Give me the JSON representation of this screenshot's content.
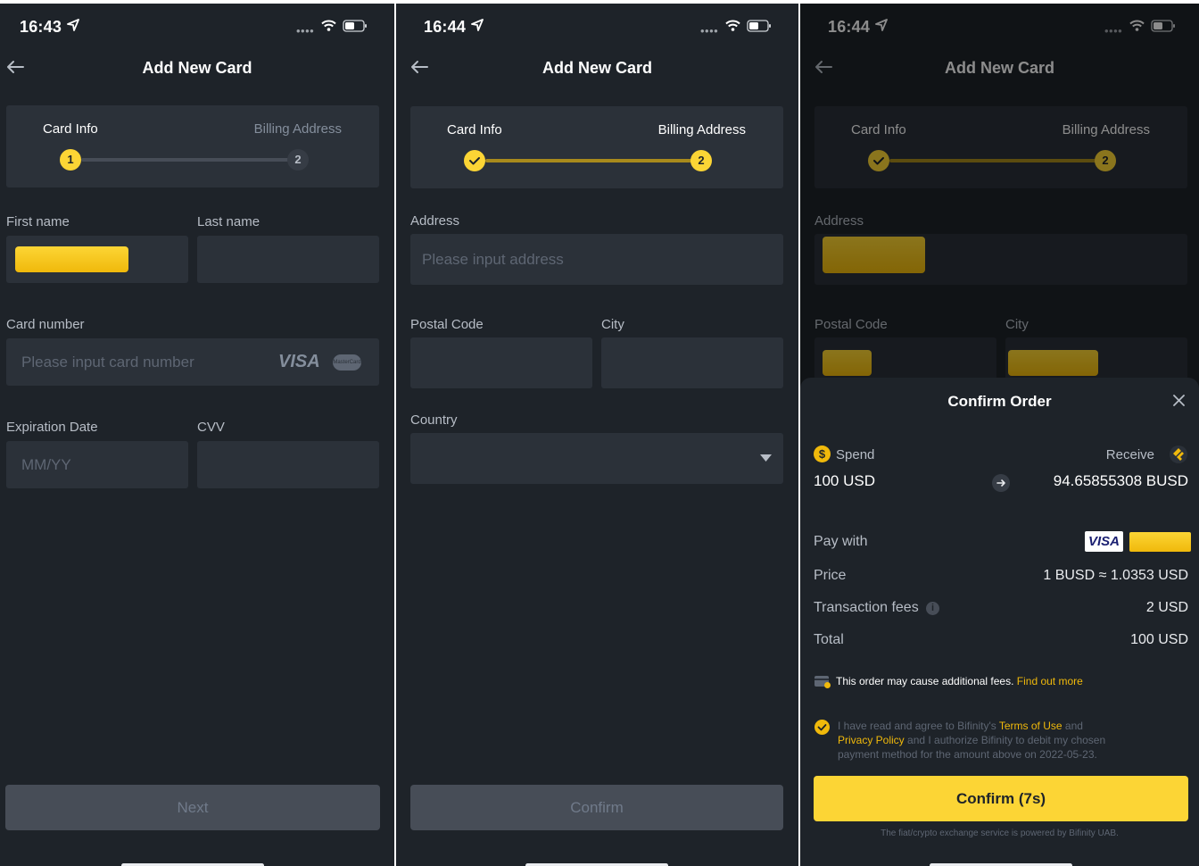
{
  "screens": [
    {
      "status": {
        "time": "16:43"
      },
      "title": "Add New Card",
      "steps": {
        "step1": "Card Info",
        "step2": "Billing Address",
        "dot1": "1",
        "dot2": "2"
      },
      "fields": {
        "first_name_label": "First name",
        "last_name_label": "Last name",
        "card_number_label": "Card number",
        "card_number_placeholder": "Please input card number",
        "expiration_label": "Expiration Date",
        "expiration_placeholder": "MM/YY",
        "cvv_label": "CVV"
      },
      "card_brands": {
        "visa": "VISA",
        "mastercard": "MasterCard"
      },
      "button": "Next"
    },
    {
      "status": {
        "time": "16:44"
      },
      "title": "Add New Card",
      "steps": {
        "step1": "Card Info",
        "step2": "Billing Address",
        "dot2": "2"
      },
      "fields": {
        "address_label": "Address",
        "address_placeholder": "Please input address",
        "postal_label": "Postal Code",
        "city_label": "City",
        "country_label": "Country"
      },
      "button": "Confirm"
    },
    {
      "status": {
        "time": "16:44"
      },
      "title": "Add New Card",
      "steps": {
        "step1": "Card Info",
        "step2": "Billing Address",
        "dot2": "2"
      },
      "fields": {
        "address_label": "Address",
        "postal_label": "Postal Code",
        "city_label": "City"
      },
      "sheet": {
        "title": "Confirm Order",
        "spend_label": "Spend",
        "spend_value": "100 USD",
        "receive_label": "Receive",
        "receive_value": "94.65855308 BUSD",
        "pay_with_label": "Pay with",
        "pay_with_brand": "VISA",
        "price_label": "Price",
        "price_value": "1 BUSD ≈ 1.0353 USD",
        "fees_label": "Transaction fees",
        "fees_value": "2 USD",
        "total_label": "Total",
        "total_value": "100 USD",
        "notice_text": "This order may cause additional fees.",
        "notice_link": "Find out more",
        "agree_1": "I have read and agree to Bifinity's",
        "agree_terms": "Terms of Use",
        "agree_and": "and",
        "agree_privacy": "Privacy Policy",
        "agree_2": "and I authorize Bifinity to debit my chosen",
        "agree_3": "payment method for the amount above on 2022-05-23.",
        "confirm_button": "Confirm (7s)",
        "footer": "The fiat/crypto exchange service is powered by Bifinity UAB."
      }
    }
  ],
  "colors": {
    "accent": "#fcd535",
    "bg": "#1e2329",
    "field": "#2b3139",
    "muted": "#707a8a"
  }
}
